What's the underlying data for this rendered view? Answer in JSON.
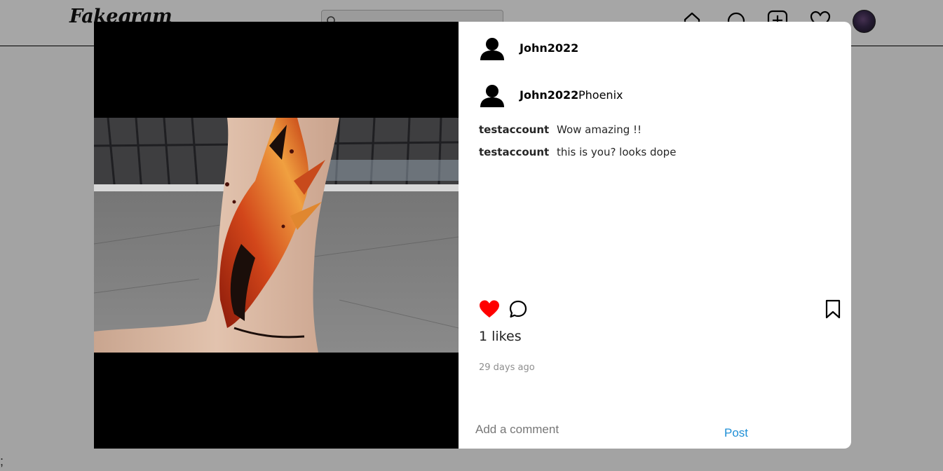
{
  "app": {
    "logo": "Fakegram"
  },
  "topnav": {
    "search_placeholder": "",
    "icons": [
      "home-icon",
      "explore-icon",
      "new-post-icon",
      "activity-heart-icon",
      "profile-avatar"
    ]
  },
  "background": {
    "stray_text": ";"
  },
  "post": {
    "author": "John2022",
    "caption_author": "John2022",
    "caption": "Phoenix",
    "comments": [
      {
        "user": "testaccount",
        "text": "Wow amazing !!"
      },
      {
        "user": "testaccount",
        "text": "this is you? looks dope"
      }
    ],
    "likes_text": "1 likes",
    "time_ago": "29 days ago",
    "liked": true
  },
  "comment_box": {
    "placeholder": "Add a comment",
    "post_label": "Post"
  },
  "colors": {
    "like": "#ff0000",
    "link": "#1f8fd6",
    "muted": "#8e8e8e"
  }
}
